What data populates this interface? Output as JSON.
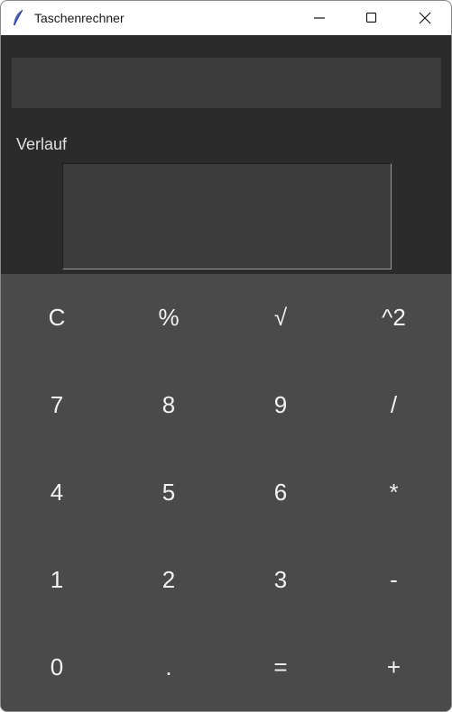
{
  "window": {
    "title": "Taschenrechner",
    "icon": "feather-icon",
    "controls": [
      "minimize-icon",
      "maximize-icon",
      "close-icon"
    ]
  },
  "display": {
    "value": ""
  },
  "history": {
    "label": "Verlauf",
    "content": ""
  },
  "keypad": {
    "rows": [
      [
        "C",
        "%",
        "√",
        "^2"
      ],
      [
        "7",
        "8",
        "9",
        "/"
      ],
      [
        "4",
        "5",
        "6",
        "*"
      ],
      [
        "1",
        "2",
        "3",
        "-"
      ],
      [
        "0",
        ".",
        "=",
        "+"
      ]
    ]
  },
  "colors": {
    "background": "#2b2b2b",
    "display": "#3c3c3c",
    "keypad": "#4a4a4a",
    "key_text": "#f2f2f2"
  }
}
